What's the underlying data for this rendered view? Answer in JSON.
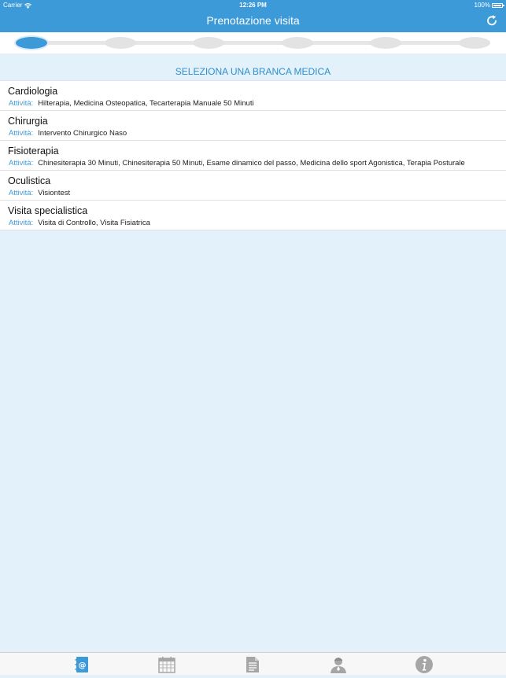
{
  "status_bar": {
    "carrier": "Carrier",
    "time": "12:26 PM",
    "battery": "100%"
  },
  "nav": {
    "title": "Prenotazione visita",
    "refresh_icon": "refresh-icon"
  },
  "stepper": {
    "total_steps": 6,
    "current_step": 1
  },
  "section": {
    "title": "SELEZIONA UNA BRANCA MEDICA"
  },
  "activity_label": "Attività:",
  "branches": [
    {
      "name": "Cardiologia",
      "activities": "Hilterapia, Medicina Osteopatica, Tecarterapia Manuale 50 Minuti"
    },
    {
      "name": "Chirurgia",
      "activities": "Intervento Chirurgico Naso"
    },
    {
      "name": "Fisioterapia",
      "activities": "Chinesiterapia 30 Minuti, Chinesiterapia 50 Minuti, Esame dinamico del passo, Medicina dello sport Agonistica, Terapia Posturale"
    },
    {
      "name": "Oculistica",
      "activities": "Visiontest"
    },
    {
      "name": "Visita specialistica",
      "activities": "Visita di Controllo, Visita Fisiatrica"
    }
  ],
  "tabs": [
    {
      "icon": "address-book-icon",
      "active": true
    },
    {
      "icon": "calendar-icon",
      "active": false
    },
    {
      "icon": "document-icon",
      "active": false
    },
    {
      "icon": "doctor-icon",
      "active": false
    },
    {
      "icon": "info-icon",
      "active": false
    }
  ],
  "colors": {
    "primary": "#3d9ad8",
    "background": "#e3f1fa",
    "section_text": "#2f8fcd",
    "inactive_icon": "#a6a6a6"
  }
}
